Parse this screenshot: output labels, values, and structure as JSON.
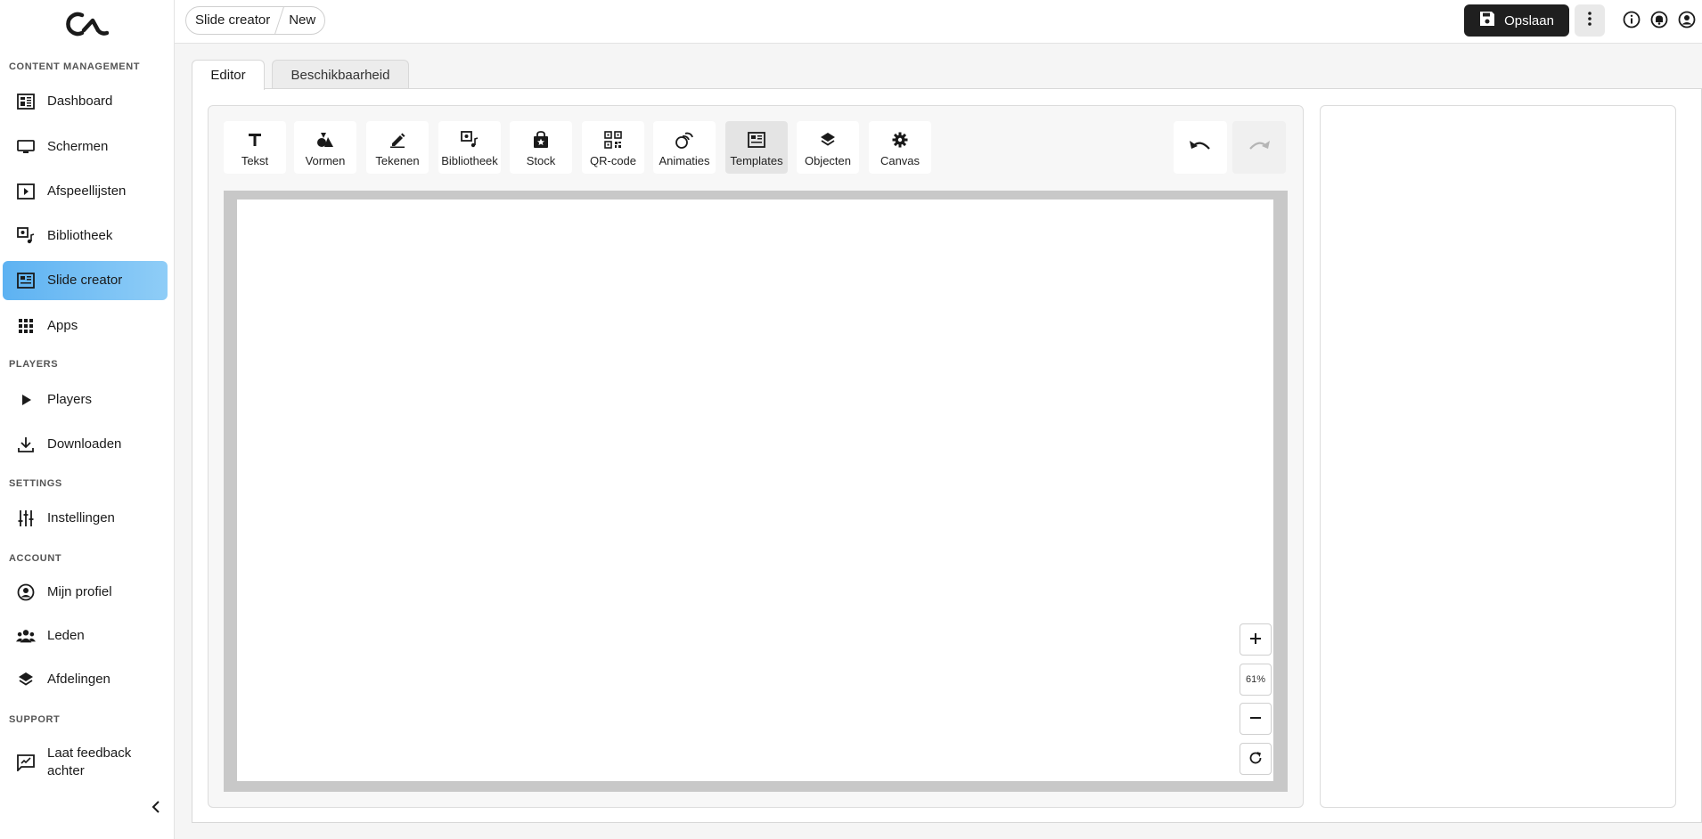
{
  "header": {
    "breadcrumb": [
      "Slide creator",
      "New"
    ],
    "save_label": "Opslaan"
  },
  "sidebar": {
    "sections": {
      "content": "CONTENT MANAGEMENT",
      "players": "PLAYERS",
      "settings": "SETTINGS",
      "account": "ACCOUNT",
      "support": "SUPPORT"
    },
    "items": {
      "dashboard": "Dashboard",
      "schermen": "Schermen",
      "afspeellijsten": "Afspeellijsten",
      "bibliotheek": "Bibliotheek",
      "slide_creator": "Slide creator",
      "apps": "Apps",
      "players": "Players",
      "downloaden": "Downloaden",
      "instellingen": "Instellingen",
      "mijn_profiel": "Mijn profiel",
      "leden": "Leden",
      "afdelingen": "Afdelingen",
      "feedback_line1": "Laat feedback",
      "feedback_line2": "achter"
    },
    "active_item": "Slide creator"
  },
  "tabs": {
    "editor": "Editor",
    "beschikbaarheid": "Beschikbaarheid"
  },
  "toolbar": {
    "tekst": "Tekst",
    "vormen": "Vormen",
    "tekenen": "Tekenen",
    "bibliotheek": "Bibliotheek",
    "stock": "Stock",
    "qr_code": "QR-code",
    "animaties": "Animaties",
    "templates": "Templates",
    "objecten": "Objecten",
    "canvas": "Canvas",
    "selected": "Templates"
  },
  "zoom": {
    "level": "61%"
  },
  "colors": {
    "active_nav": "#5db2f2",
    "save_button": "#1f1f1f"
  }
}
